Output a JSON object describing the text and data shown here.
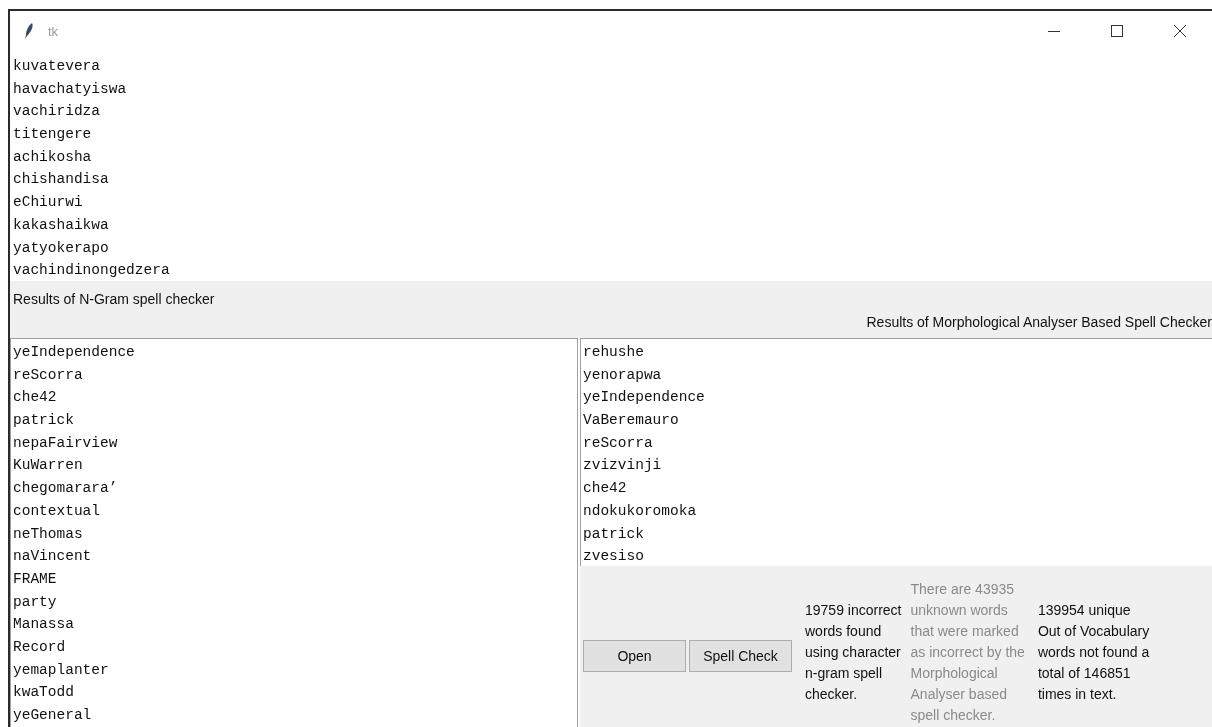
{
  "window": {
    "title": "tk"
  },
  "input_text": {
    "lines": [
      "kuvatevera",
      "havachatyiswa",
      "vachiridza",
      "titengere",
      "achikosha",
      "chishandisa",
      "eChiurwi",
      "kakashaikwa",
      "yatyokerapo",
      "vachindinongedzera"
    ]
  },
  "ngram_heading": "Results of N-Gram spell checker",
  "morph_heading": "Results of Morphological Analyser Based Spell Checker",
  "ngram_results": {
    "lines": [
      "yeIndependence",
      "reScorra",
      "che42",
      "patrick",
      "nepaFairview",
      "KuWarren",
      "chegomarara’",
      "contextual",
      "neThomas",
      "naVincent",
      "FRAME",
      "party",
      "Manassa",
      "Record",
      "yemaplanter",
      "kwaTodd",
      "yeGeneral"
    ]
  },
  "morph_results": {
    "lines": [
      "rehushe",
      "yenorapwa",
      "yeIndependence",
      "VaBeremauro",
      "reScorra",
      "zvizvinji",
      "che42",
      "ndokukoromoka",
      "patrick",
      "zvesiso"
    ]
  },
  "buttons": [
    {
      "label": "Open"
    },
    {
      "label": "Spell Check"
    }
  ],
  "summaries": [
    {
      "text": "19759 incorrect\nwords found\nusing character\nn-gram spell\nchecker.",
      "disabled": false
    },
    {
      "text": "There are 43935\nunknown words\nthat were marked\nas incorrect by the\nMorphological\nAnalyser based\nspell checker.",
      "disabled": true
    },
    {
      "text": "139954 unique\nOut of Vocabulary\nwords not found a\ntotal of 146851\ntimes in text.",
      "disabled": false
    }
  ]
}
